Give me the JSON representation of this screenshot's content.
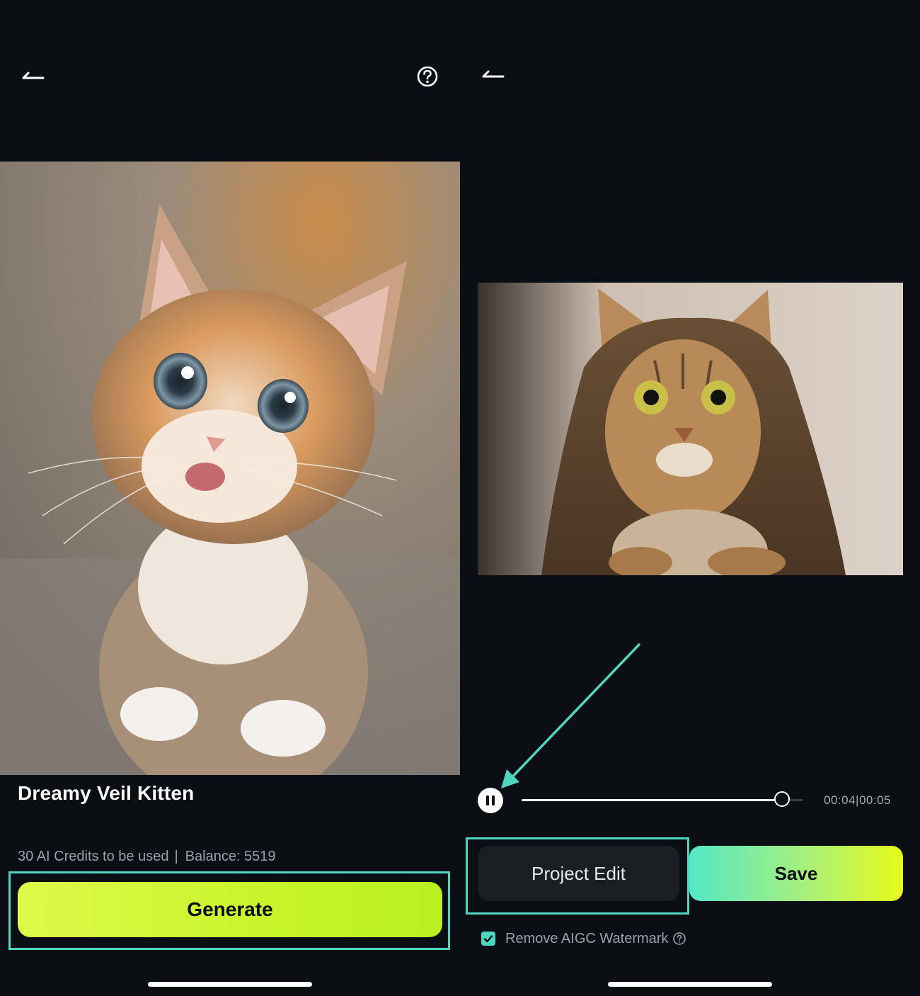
{
  "left": {
    "effect_title": "Dreamy Veil Kitten",
    "credits_text": "30 AI Credits to be used",
    "balance_text": "Balance: 5519",
    "generate_label": "Generate"
  },
  "right": {
    "time_current": "00:04",
    "time_total": "00:05",
    "playback_progress": 0.925,
    "project_edit_label": "Project Edit",
    "save_label": "Save",
    "watermark_label": "Remove AIGC Watermark",
    "watermark_checked": true
  },
  "colors": {
    "accent_teal": "#4fd6be",
    "generate_green": "#c7f52a",
    "background": "#0b0f13"
  },
  "icons": {
    "back": "back-arrow-icon",
    "help": "help-icon",
    "pause": "pause-icon",
    "check": "check-icon",
    "info": "info-icon"
  }
}
